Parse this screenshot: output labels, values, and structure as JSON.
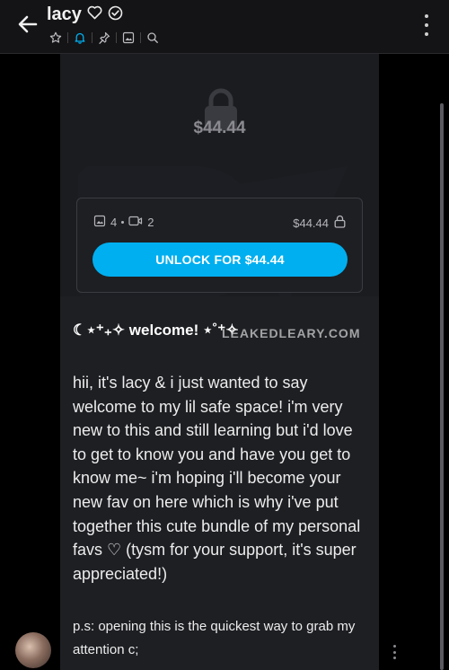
{
  "header": {
    "title": "lacy",
    "title_suffix_icons": [
      "heart-outline-icon",
      "verified-badge-icon"
    ],
    "actions": [
      {
        "name": "star-icon"
      },
      {
        "name": "bell-icon",
        "active": true
      },
      {
        "name": "pin-icon"
      },
      {
        "name": "image-icon"
      },
      {
        "name": "search-icon"
      }
    ]
  },
  "locked_media": {
    "price": "$44.44",
    "image_count": "4",
    "video_count": "2",
    "card_price": "$44.44",
    "unlock_label": "UNLOCK FOR $44.44"
  },
  "post": {
    "heading": "☾⋆⁺₊✧ welcome! ⋆˚⁺✧",
    "watermark": "LEAKEDLEARY.COM",
    "body": "hii, it's lacy & i just wanted to say welcome to my lil safe space! i'm very new to this and still learning but i'd love to get to know you and have you get to know me~ i'm hoping i'll become your new fav on here which is why i've put together this cute bundle of my personal favs ♡ (tysm for your support, it's super appreciated!)",
    "ps": "p.s: opening this is the quickest way to grab my attention c;"
  },
  "colors": {
    "accent": "#00aff0",
    "background": "#000000",
    "post_bg": "#1e1f23"
  }
}
